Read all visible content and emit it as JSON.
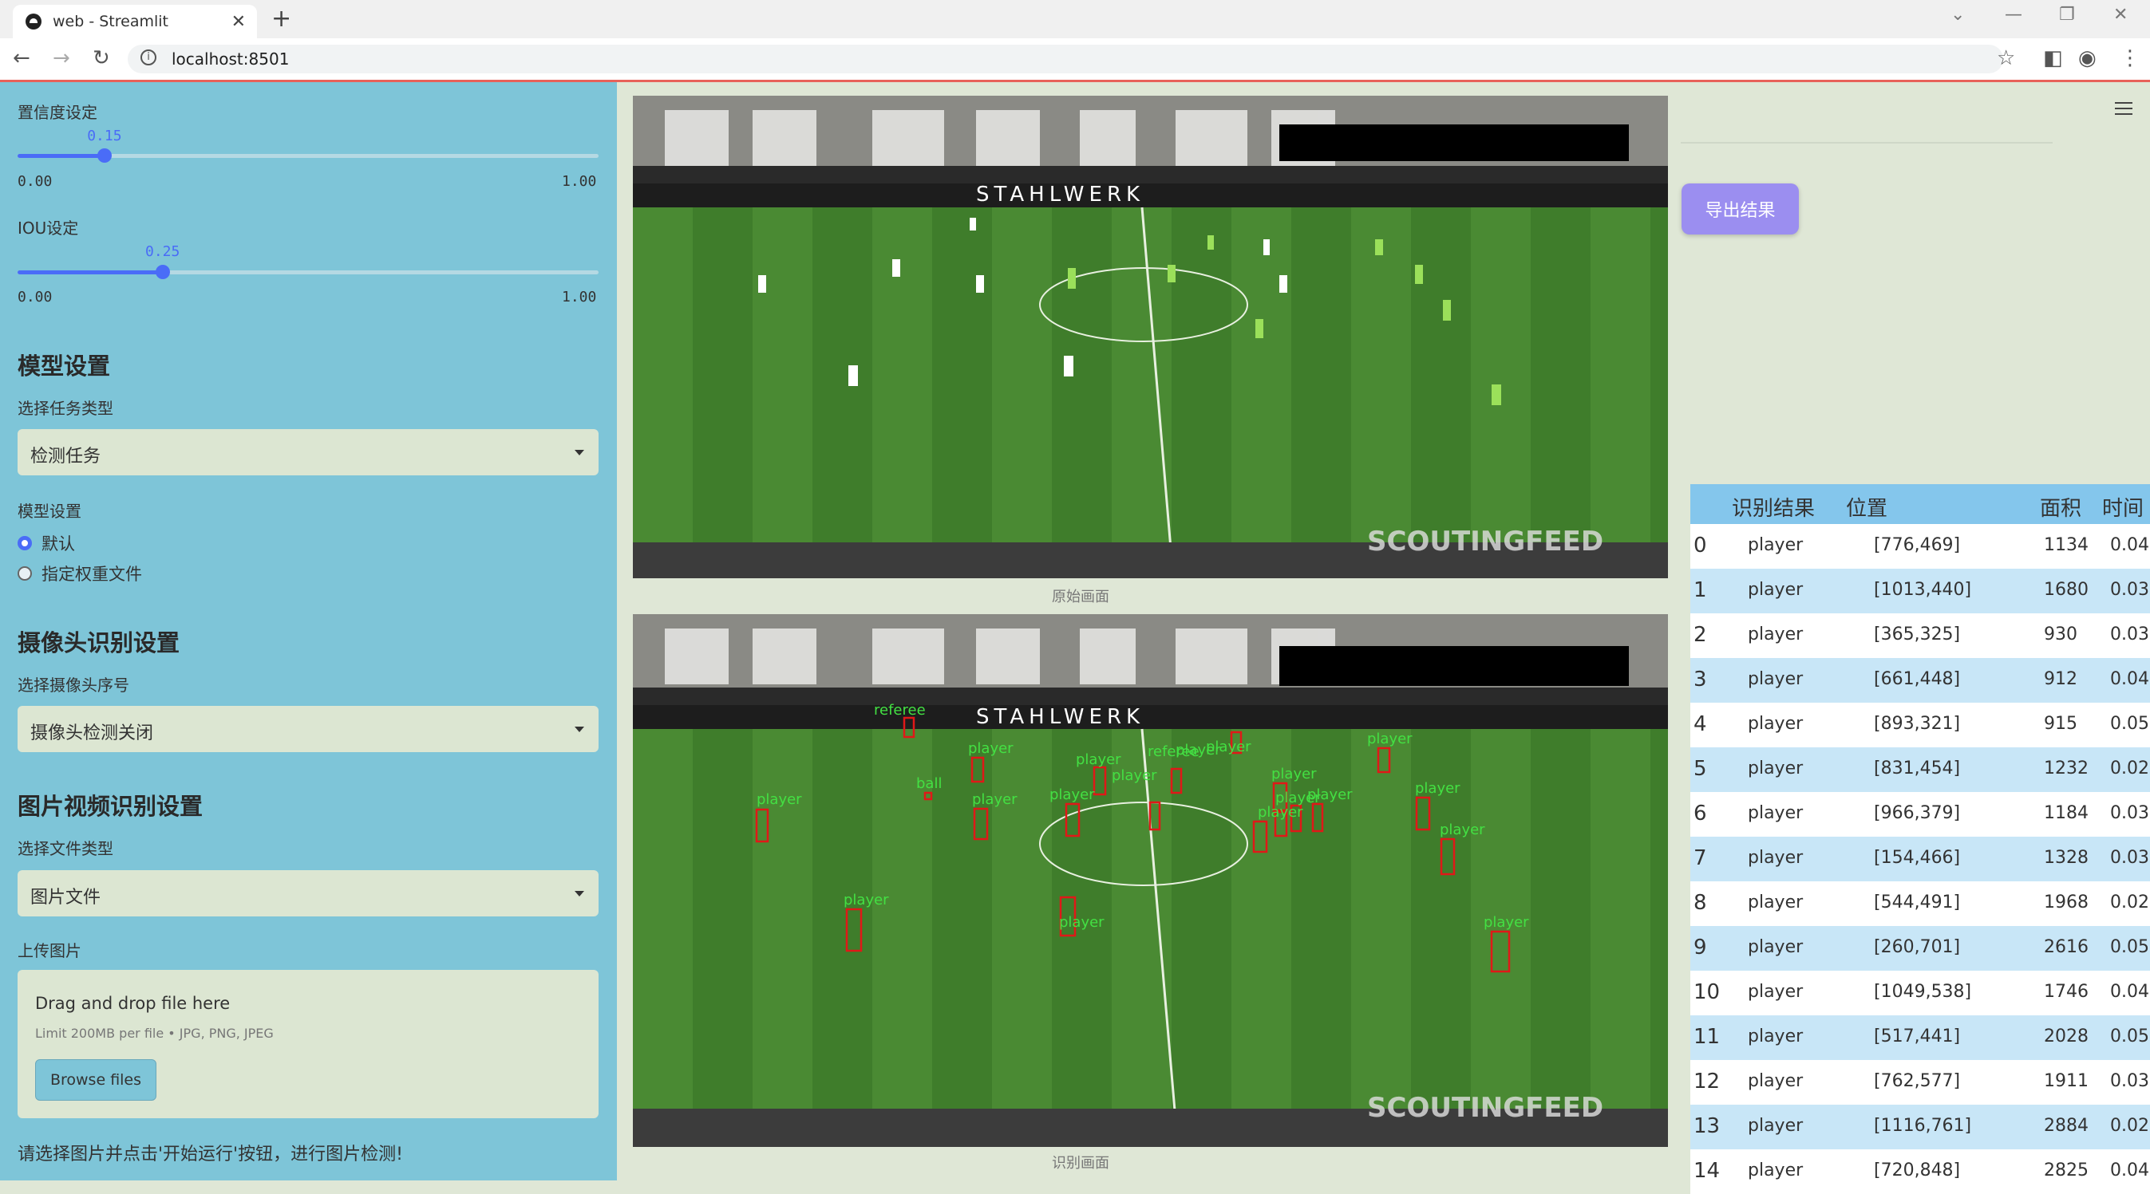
{
  "browser": {
    "tab_title": "web - Streamlit",
    "url": "localhost:8501"
  },
  "sidebar": {
    "confidence": {
      "label": "置信度设定",
      "value": "0.15",
      "min": "0.00",
      "max": "1.00",
      "fraction": 0.15
    },
    "iou": {
      "label": "IOU设定",
      "value": "0.25",
      "min": "0.00",
      "max": "1.00",
      "fraction": 0.25
    },
    "model_section": "模型设置",
    "task_label": "选择任务类型",
    "task_value": "检测任务",
    "model_label": "模型设置",
    "model_options": [
      "默认",
      "指定权重文件"
    ],
    "camera_section": "摄像头识别设置",
    "camera_label": "选择摄像头序号",
    "camera_value": "摄像头检测关闭",
    "media_section": "图片视频识别设置",
    "file_type_label": "选择文件类型",
    "file_type_value": "图片文件",
    "upload_label": "上传图片",
    "upload_drag": "Drag and drop file here",
    "upload_limit": "Limit 200MB per file • JPG, PNG, JPEG",
    "browse": "Browse files",
    "hint": "请选择图片并点击'开始运行'按钮，进行图片检测!"
  },
  "main": {
    "original_caption": "原始画面",
    "result_caption": "识别画面",
    "watermark": "SCOUTINGFEED",
    "board_text": "STAHLWERK",
    "detection_labels": [
      "player",
      "referee",
      "ball"
    ]
  },
  "right": {
    "export": "导出结果",
    "table": {
      "headers": [
        "识别结果",
        "位置",
        "面积",
        "时间"
      ],
      "rows": [
        [
          "0",
          "player",
          "[776,469]",
          "1134",
          "0.04"
        ],
        [
          "1",
          "player",
          "[1013,440]",
          "1680",
          "0.03"
        ],
        [
          "2",
          "player",
          "[365,325]",
          "930",
          "0.03"
        ],
        [
          "3",
          "player",
          "[661,448]",
          "912",
          "0.04"
        ],
        [
          "4",
          "player",
          "[893,321]",
          "915",
          "0.05"
        ],
        [
          "5",
          "player",
          "[831,454]",
          "1232",
          "0.02"
        ],
        [
          "6",
          "player",
          "[966,379]",
          "1184",
          "0.03"
        ],
        [
          "7",
          "player",
          "[154,466]",
          "1328",
          "0.03"
        ],
        [
          "8",
          "player",
          "[544,491]",
          "1968",
          "0.02"
        ],
        [
          "9",
          "player",
          "[260,701]",
          "2616",
          "0.05"
        ],
        [
          "10",
          "player",
          "[1049,538]",
          "1746",
          "0.04"
        ],
        [
          "11",
          "player",
          "[517,441]",
          "2028",
          "0.05"
        ],
        [
          "12",
          "player",
          "[762,577]",
          "1911",
          "0.03"
        ],
        [
          "13",
          "player",
          "[1116,761]",
          "2884",
          "0.02"
        ],
        [
          "14",
          "player",
          "[720,848]",
          "2825",
          "0.04"
        ]
      ]
    }
  }
}
